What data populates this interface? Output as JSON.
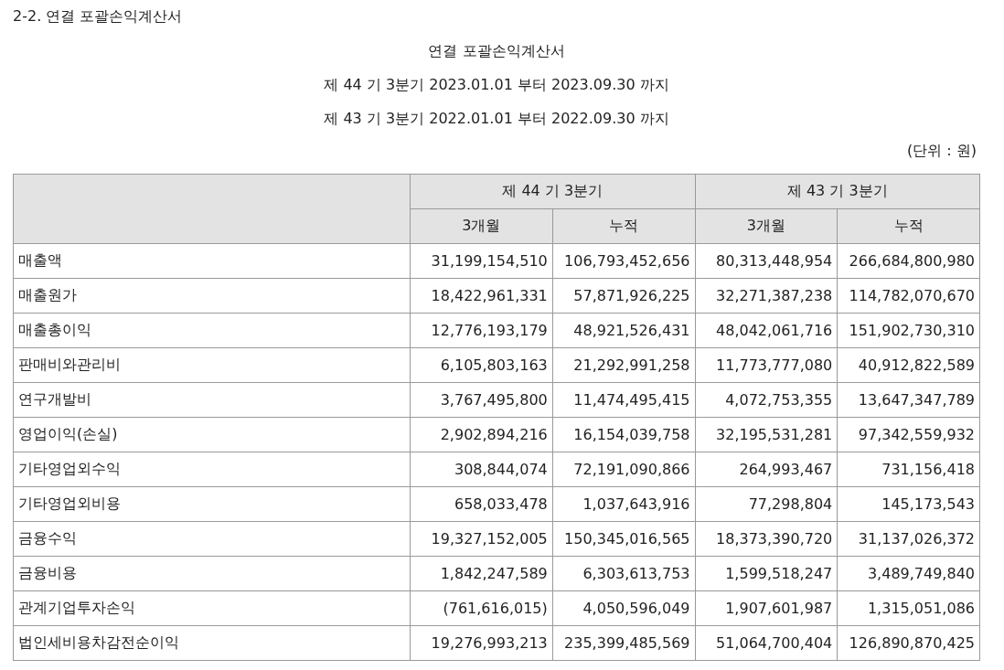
{
  "section_title": "2-2. 연결 포괄손익계산서",
  "report_title": "연결 포괄손익계산서",
  "periods": [
    "제 44 기 3분기 2023.01.01 부터 2023.09.30 까지",
    "제 43 기 3분기 2022.01.01 부터 2022.09.30 까지"
  ],
  "unit": "(단위 : 원)",
  "table": {
    "column_groups": [
      {
        "label": "제 44 기 3분기",
        "subcolumns": [
          "3개월",
          "누적"
        ]
      },
      {
        "label": "제 43 기 3분기",
        "subcolumns": [
          "3개월",
          "누적"
        ]
      }
    ],
    "rows": [
      {
        "label": "매출액",
        "values": [
          "31,199,154,510",
          "106,793,452,656",
          "80,313,448,954",
          "266,684,800,980"
        ]
      },
      {
        "label": "매출원가",
        "values": [
          "18,422,961,331",
          "57,871,926,225",
          "32,271,387,238",
          "114,782,070,670"
        ]
      },
      {
        "label": "매출총이익",
        "values": [
          "12,776,193,179",
          "48,921,526,431",
          "48,042,061,716",
          "151,902,730,310"
        ]
      },
      {
        "label": "판매비와관리비",
        "values": [
          "6,105,803,163",
          "21,292,991,258",
          "11,773,777,080",
          "40,912,822,589"
        ]
      },
      {
        "label": "연구개발비",
        "values": [
          "3,767,495,800",
          "11,474,495,415",
          "4,072,753,355",
          "13,647,347,789"
        ]
      },
      {
        "label": "영업이익(손실)",
        "values": [
          "2,902,894,216",
          "16,154,039,758",
          "32,195,531,281",
          "97,342,559,932"
        ]
      },
      {
        "label": "기타영업외수익",
        "values": [
          "308,844,074",
          "72,191,090,866",
          "264,993,467",
          "731,156,418"
        ]
      },
      {
        "label": "기타영업외비용",
        "values": [
          "658,033,478",
          "1,037,643,916",
          "77,298,804",
          "145,173,543"
        ]
      },
      {
        "label": "금융수익",
        "values": [
          "19,327,152,005",
          "150,345,016,565",
          "18,373,390,720",
          "31,137,026,372"
        ]
      },
      {
        "label": "금융비용",
        "values": [
          "1,842,247,589",
          "6,303,613,753",
          "1,599,518,247",
          "3,489,749,840"
        ]
      },
      {
        "label": "관계기업투자손익",
        "values": [
          "(761,616,015)",
          "4,050,596,049",
          "1,907,601,987",
          "1,315,051,086"
        ]
      },
      {
        "label": "법인세비용차감전순이익",
        "values": [
          "19,276,993,213",
          "235,399,485,569",
          "51,064,700,404",
          "126,890,870,425"
        ]
      }
    ]
  }
}
